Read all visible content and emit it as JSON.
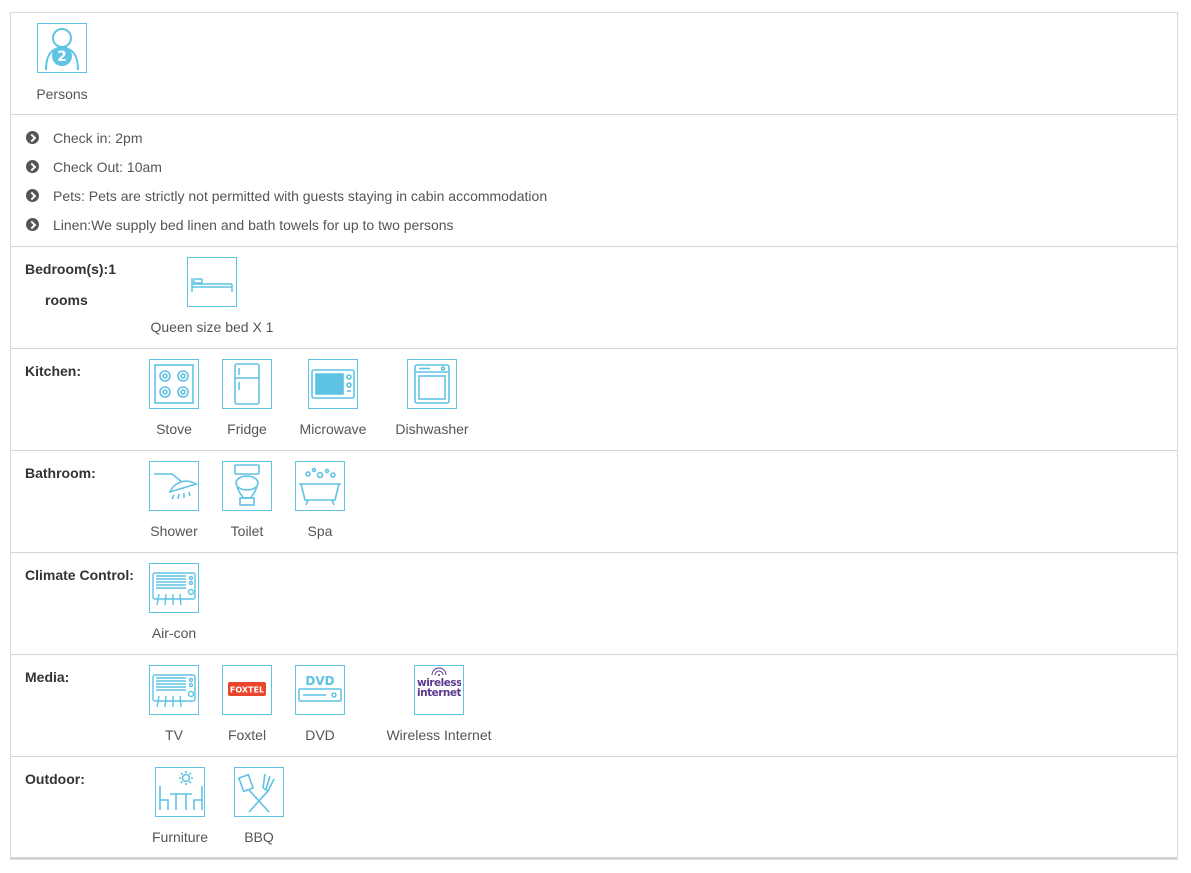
{
  "persons": {
    "count": "2",
    "label": "Persons"
  },
  "info": [
    "Check in: 2pm",
    "Check Out: 10am",
    "Pets: Pets are strictly not permitted with guests staying in cabin accommodation",
    "Linen:We supply bed linen and bath towels for up to two persons"
  ],
  "bedroom": {
    "title": "Bedroom(s):1",
    "sub": "rooms",
    "items": [
      {
        "label": "Queen size bed X 1",
        "icon": "bed-icon"
      }
    ]
  },
  "kitchen": {
    "title": "Kitchen:",
    "items": [
      {
        "label": "Stove",
        "icon": "stove-icon"
      },
      {
        "label": "Fridge",
        "icon": "fridge-icon"
      },
      {
        "label": "Microwave",
        "icon": "microwave-icon"
      },
      {
        "label": "Dishwasher",
        "icon": "dishwasher-icon"
      }
    ]
  },
  "bathroom": {
    "title": "Bathroom:",
    "items": [
      {
        "label": "Shower",
        "icon": "shower-icon"
      },
      {
        "label": "Toilet",
        "icon": "toilet-icon"
      },
      {
        "label": "Spa",
        "icon": "spa-icon"
      }
    ]
  },
  "climate": {
    "title": "Climate Control:",
    "items": [
      {
        "label": "Air-con",
        "icon": "aircon-icon"
      }
    ]
  },
  "media": {
    "title": "Media:",
    "items": [
      {
        "label": "TV",
        "icon": "tv-icon"
      },
      {
        "label": "Foxtel",
        "icon": "foxtel-icon",
        "logo_text": "FOXTEL"
      },
      {
        "label": "DVD",
        "icon": "dvd-icon",
        "logo_text": "DVD"
      },
      {
        "label": "Wireless Internet",
        "icon": "wireless-internet-icon",
        "logo_text": "wireless internet"
      }
    ]
  },
  "outdoor": {
    "title": "Outdoor:",
    "items": [
      {
        "label": "Furniture",
        "icon": "outdoor-furniture-icon"
      },
      {
        "label": "BBQ",
        "icon": "bbq-icon"
      }
    ]
  },
  "colors": {
    "icon_accent": "#5fc3e4",
    "foxtel_red": "#e8452c",
    "wireless_purple": "#5b3a8f",
    "text": "#555555",
    "heading": "#333333",
    "border": "#d4d4d4"
  }
}
